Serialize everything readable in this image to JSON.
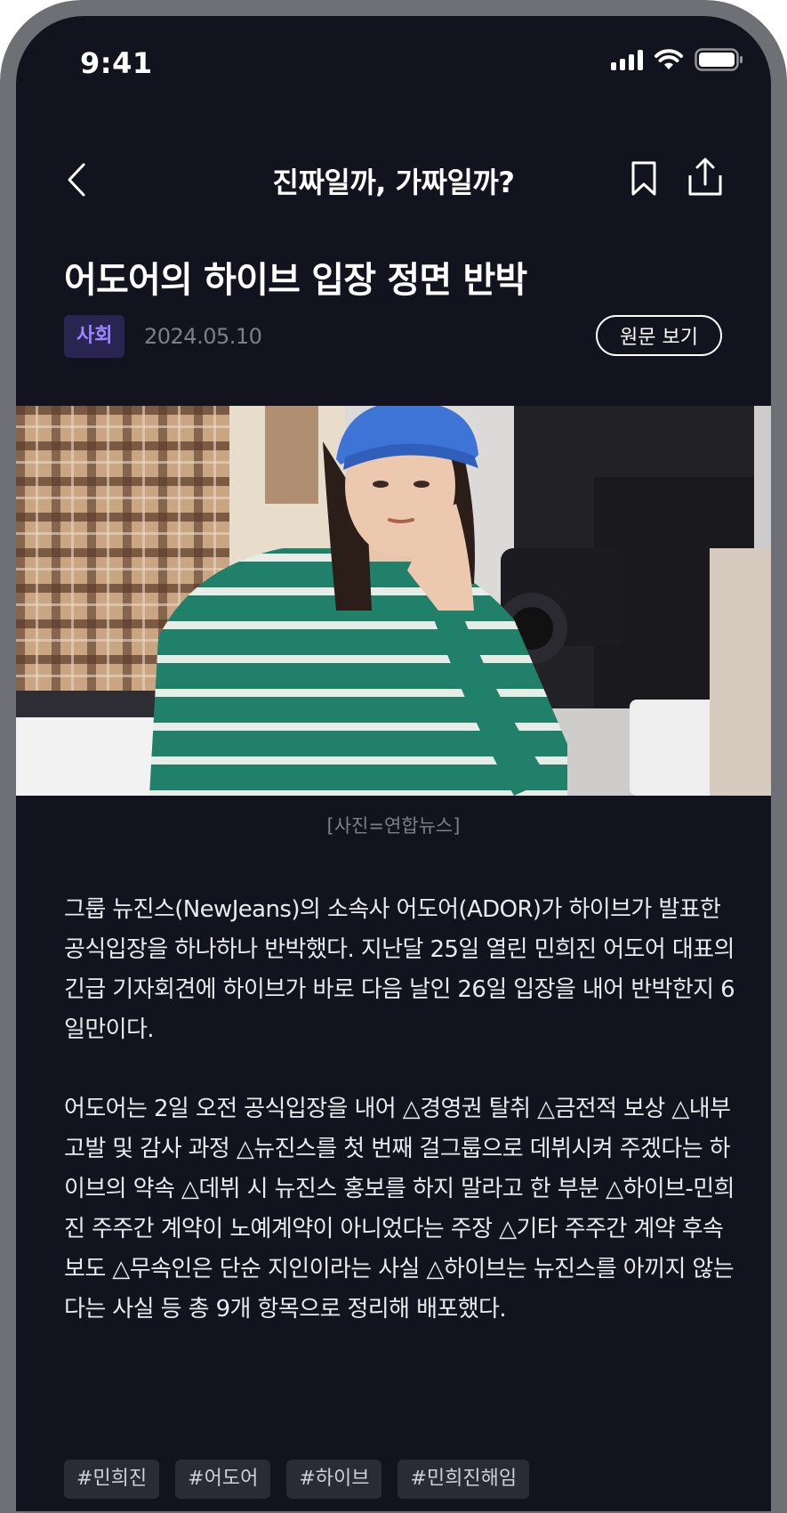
{
  "status_bar": {
    "time": "9:41",
    "icons": [
      "signal-icon",
      "wifi-icon",
      "battery-icon"
    ]
  },
  "nav": {
    "title": "진짜일까, 가짜일까?",
    "icons": [
      "back-chevron-icon",
      "bookmark-icon",
      "share-icon"
    ]
  },
  "article": {
    "title": "어도어의 하이브 입장 정면 반박",
    "category": "사회",
    "date": "2024.05.10",
    "original_button_label": "원문 보기",
    "photo_caption": "[사진=연합뉴스]",
    "paragraphs": [
      "그룹 뉴진스(NewJeans)의 소속사 어도어(ADOR)가 하이브가 발표한 공식입장을 하나하나 반박했다. 지난달 25일 열린 민희진 어도어 대표의 긴급 기자회견에 하이브가 바로 다음 날인 26일 입장을 내어 반박한지 6일만이다.",
      "어도어는 2일 오전 공식입장을 내어 △경영권 탈취 △금전적 보상 △내부 고발 및 감사 과정 △뉴진스를 첫 번째 걸그룹으로 데뷔시켜 주겠다는 하이브의 약속 △데뷔 시 뉴진스 홍보를 하지 말라고 한 부분 △하이브-민희진 주주간 계약이 노예계약이 아니었다는 주장 △기타 주주간 계약 후속 보도 △무속인은 단순 지인이라는 사실 △하이브는 뉴진스를 아끼지 않는다는 사실 등 총 9개 항목으로 정리해 배포했다."
    ],
    "tags": [
      "#민희진",
      "#어도어",
      "#하이브",
      "#민희진해임"
    ]
  },
  "colors": {
    "background": "#13131f",
    "category_text": "#9b86ff",
    "category_bg": "#2a2450",
    "muted_text": "#7d7e8b",
    "bezel": "#6f7075"
  }
}
